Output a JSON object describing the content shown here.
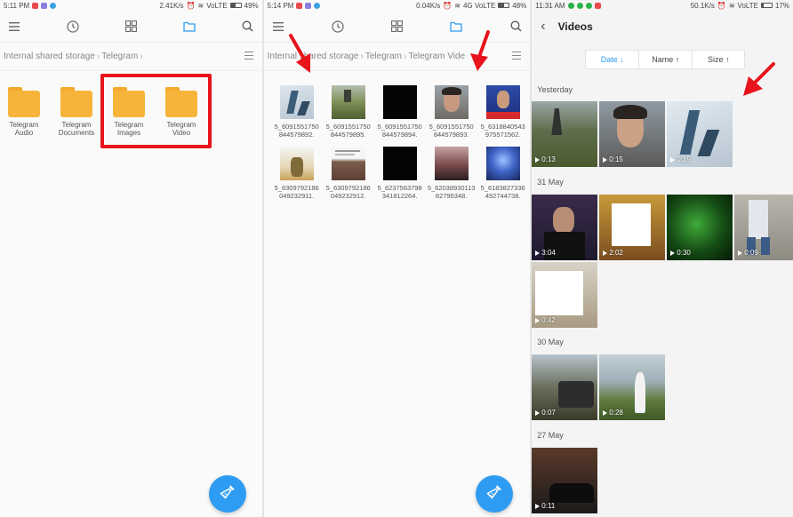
{
  "screen1": {
    "status": {
      "time": "5:11 PM",
      "speed": "2.41K/s",
      "network": "VoLTE",
      "battery": "49%"
    },
    "breadcrumb": [
      "Internal shared storage",
      "Telegram"
    ],
    "folders": [
      {
        "label": "Telegram Audio"
      },
      {
        "label": "Telegram Documents"
      },
      {
        "label": "Telegram Images"
      },
      {
        "label": "Telegram Video"
      }
    ]
  },
  "screen2": {
    "status": {
      "time": "5:14 PM",
      "speed": "0.04K/s",
      "network": "4G VoLTE",
      "battery": "48%"
    },
    "breadcrumb": [
      "Internal shared storage",
      "Telegram",
      "Telegram Vide"
    ],
    "files": [
      {
        "name": "5_6091551750844579892."
      },
      {
        "name": "5_6091551750844579895."
      },
      {
        "name": "5_6091551750844579894."
      },
      {
        "name": "5_6091551750844579893."
      },
      {
        "name": "5_6318840543975571562."
      },
      {
        "name": "5_6309792186049232911."
      },
      {
        "name": "5_6309792186049232912."
      },
      {
        "name": "5_6237563798341812264."
      },
      {
        "name": "5_6203893011382796348."
      },
      {
        "name": "5_6183827336492744738."
      }
    ]
  },
  "screen3": {
    "status": {
      "time": "11:31 AM",
      "speed": "50.1K/s",
      "network": "VoLTE",
      "battery": "17%"
    },
    "title": "Videos",
    "sort": {
      "date": "Date",
      "name": "Name",
      "size": "Size"
    },
    "sections": [
      {
        "title": "Yesterday",
        "durations": [
          "0:13",
          "0:15",
          "0:15"
        ]
      },
      {
        "title": "31 May",
        "durations": [
          "3:04",
          "2:02",
          "0:30",
          "0:09",
          "0:42"
        ]
      },
      {
        "title": "30 May",
        "durations": [
          "0:07",
          "0:28"
        ]
      },
      {
        "title": "27 May",
        "durations": [
          "0:11"
        ]
      }
    ]
  },
  "colors": {
    "accent": "#2e9cf2",
    "folder": "#f7b43a",
    "highlight": "#e8131b"
  }
}
